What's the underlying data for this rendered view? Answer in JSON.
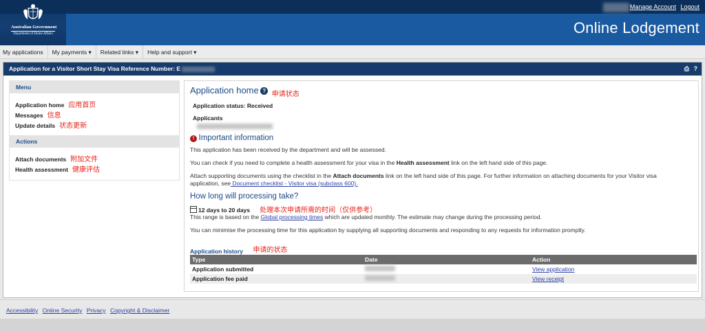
{
  "header": {
    "gov_name": "Australian Government",
    "dept_name": "Department of Home Affairs",
    "manage_account": "Manage Account",
    "logout": "Logout",
    "app_title": "Online Lodgement"
  },
  "nav": {
    "my_applications": "My applications",
    "my_payments": "My payments ▾",
    "related_links": "Related links ▾",
    "help_support": "Help and support ▾"
  },
  "panel": {
    "title": "Application for a Visitor Short Stay Visa Reference Number: E",
    "print_icon": "print-icon",
    "help_icon": "help-icon"
  },
  "sidebar": {
    "menu_title": "Menu",
    "menu_items": [
      {
        "label": "Application home",
        "annotation": "应用首页"
      },
      {
        "label": "Messages",
        "annotation": "信息"
      },
      {
        "label": "Update details",
        "annotation": "状态更新"
      }
    ],
    "actions_title": "Actions",
    "action_items": [
      {
        "label": "Attach documents",
        "annotation": "附加文件"
      },
      {
        "label": "Health assessment",
        "annotation": "健康评估"
      }
    ]
  },
  "content": {
    "title": "Application home",
    "title_annotation": "申请状态",
    "status_line": "Application status: Received",
    "applicants_label": "Applicants",
    "important_title": "Important information",
    "p1": "This application has been received by the department and will be assessed.",
    "p2_pre": "You can check if you need to complete a health assessment for your visa in the ",
    "p2_bold": "Health assessment",
    "p2_post": " link on the left hand side of this page.",
    "p3_pre": "Attach supporting documents using the checklist in the ",
    "p3_bold": "Attach documents",
    "p3_mid": " link on the left hand side of this page. For further information on attaching documents for your Visitor visa application, see",
    "p3_link": " Document checklist - Visitor visa (subclass 600).",
    "processing_title": "How long will processing take?",
    "processing_time": "12 days to 20 days",
    "processing_annotation": "处理本次申请所需的时间（仅供参考）",
    "p4_pre": "This range is based on the ",
    "p4_link": "Global processing times",
    "p4_post": " which are updated monthly. The estimate may change during the processing period.",
    "p5": "You can minimise the processing time for this application by supplying all supporting documents and responding to any requests for information promptly.",
    "history_title": "Application history",
    "history_annotation": "申请的状态",
    "history_cols": {
      "type": "Type",
      "date": "Date",
      "action": "Action"
    },
    "history_rows": [
      {
        "type": "Application submitted",
        "action": "View application"
      },
      {
        "type": "Application fee paid",
        "action": "View receipt"
      }
    ]
  },
  "footer": {
    "accessibility": "Accessibility",
    "online_security": "Online Security",
    "privacy": "Privacy",
    "copyright": "Copyright & Disclaimer"
  },
  "colors": {
    "header_dark": "#0f3767",
    "header_blue": "#1a5aa0",
    "panel_header": "#173c6c",
    "heading_blue": "#1a4a8a",
    "annotation_red": "#e8231a",
    "link": "#2a3fa5"
  }
}
